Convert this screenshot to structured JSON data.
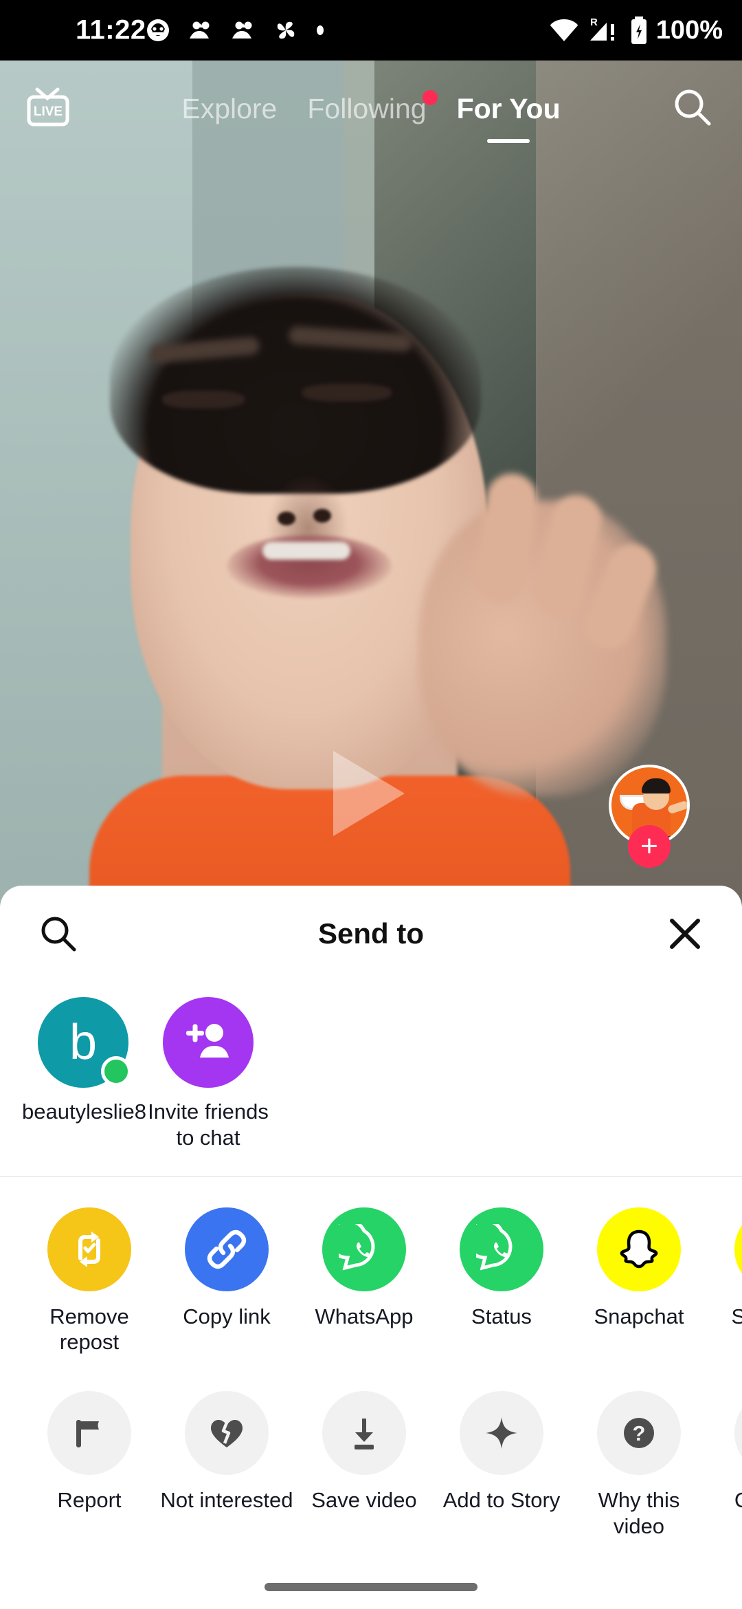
{
  "status_bar": {
    "time": "11:22",
    "battery_text": "100%",
    "icons": [
      "cat-face-icon",
      "people-icon",
      "people-icon",
      "pinwheel-icon",
      "dot-icon"
    ],
    "right_icons": [
      "wifi-icon",
      "roaming-signal-icon",
      "battery-charging-icon"
    ]
  },
  "top_nav": {
    "live_label": "LIVE",
    "tabs": [
      {
        "label": "Explore",
        "active": false,
        "badge": false
      },
      {
        "label": "Following",
        "active": false,
        "badge": true
      },
      {
        "label": "For You",
        "active": true,
        "badge": false
      }
    ],
    "search_icon": "search-icon"
  },
  "video": {
    "play_icon": "play-triangle-icon",
    "author_avatar": "author-avatar",
    "follow_label": "+"
  },
  "sheet": {
    "title": "Send to",
    "search_icon": "search-icon",
    "close_icon": "close-icon",
    "contacts": [
      {
        "name": "beautyleslie8",
        "initial": "b",
        "color": "#0e9aa7",
        "online": true,
        "type": "user"
      },
      {
        "name": "Invite friends to chat",
        "initial": "",
        "color": "#a435f0",
        "online": false,
        "type": "invite"
      }
    ],
    "share_row": [
      {
        "label": "Remove repost",
        "icon": "repost-icon",
        "color": "#f5c518"
      },
      {
        "label": "Copy link",
        "icon": "link-icon",
        "color": "#3b74f0"
      },
      {
        "label": "WhatsApp",
        "icon": "whatsapp-icon",
        "color": "#25d366"
      },
      {
        "label": "Status",
        "icon": "whatsapp-status-icon",
        "color": "#25d366"
      },
      {
        "label": "Snapchat",
        "icon": "snapchat-icon",
        "color": "#fffc00"
      },
      {
        "label": "Snapchat chat",
        "icon": "snapchat-icon",
        "color": "#fffc00"
      }
    ],
    "action_row": [
      {
        "label": "Report",
        "icon": "flag-icon"
      },
      {
        "label": "Not interested",
        "icon": "broken-heart-icon"
      },
      {
        "label": "Save video",
        "icon": "download-icon"
      },
      {
        "label": "Add to Story",
        "icon": "sparkle-icon"
      },
      {
        "label": "Why this video",
        "icon": "question-mark-icon"
      },
      {
        "label": "Captions",
        "icon": "captions-aa-icon"
      }
    ]
  },
  "system": {
    "home_indicator": "home-indicator"
  },
  "colors": {
    "accent_red": "#fe2c55",
    "sheet_bg": "#ffffff",
    "gray_icon_bg": "#f1f1f2",
    "text": "#161823"
  }
}
